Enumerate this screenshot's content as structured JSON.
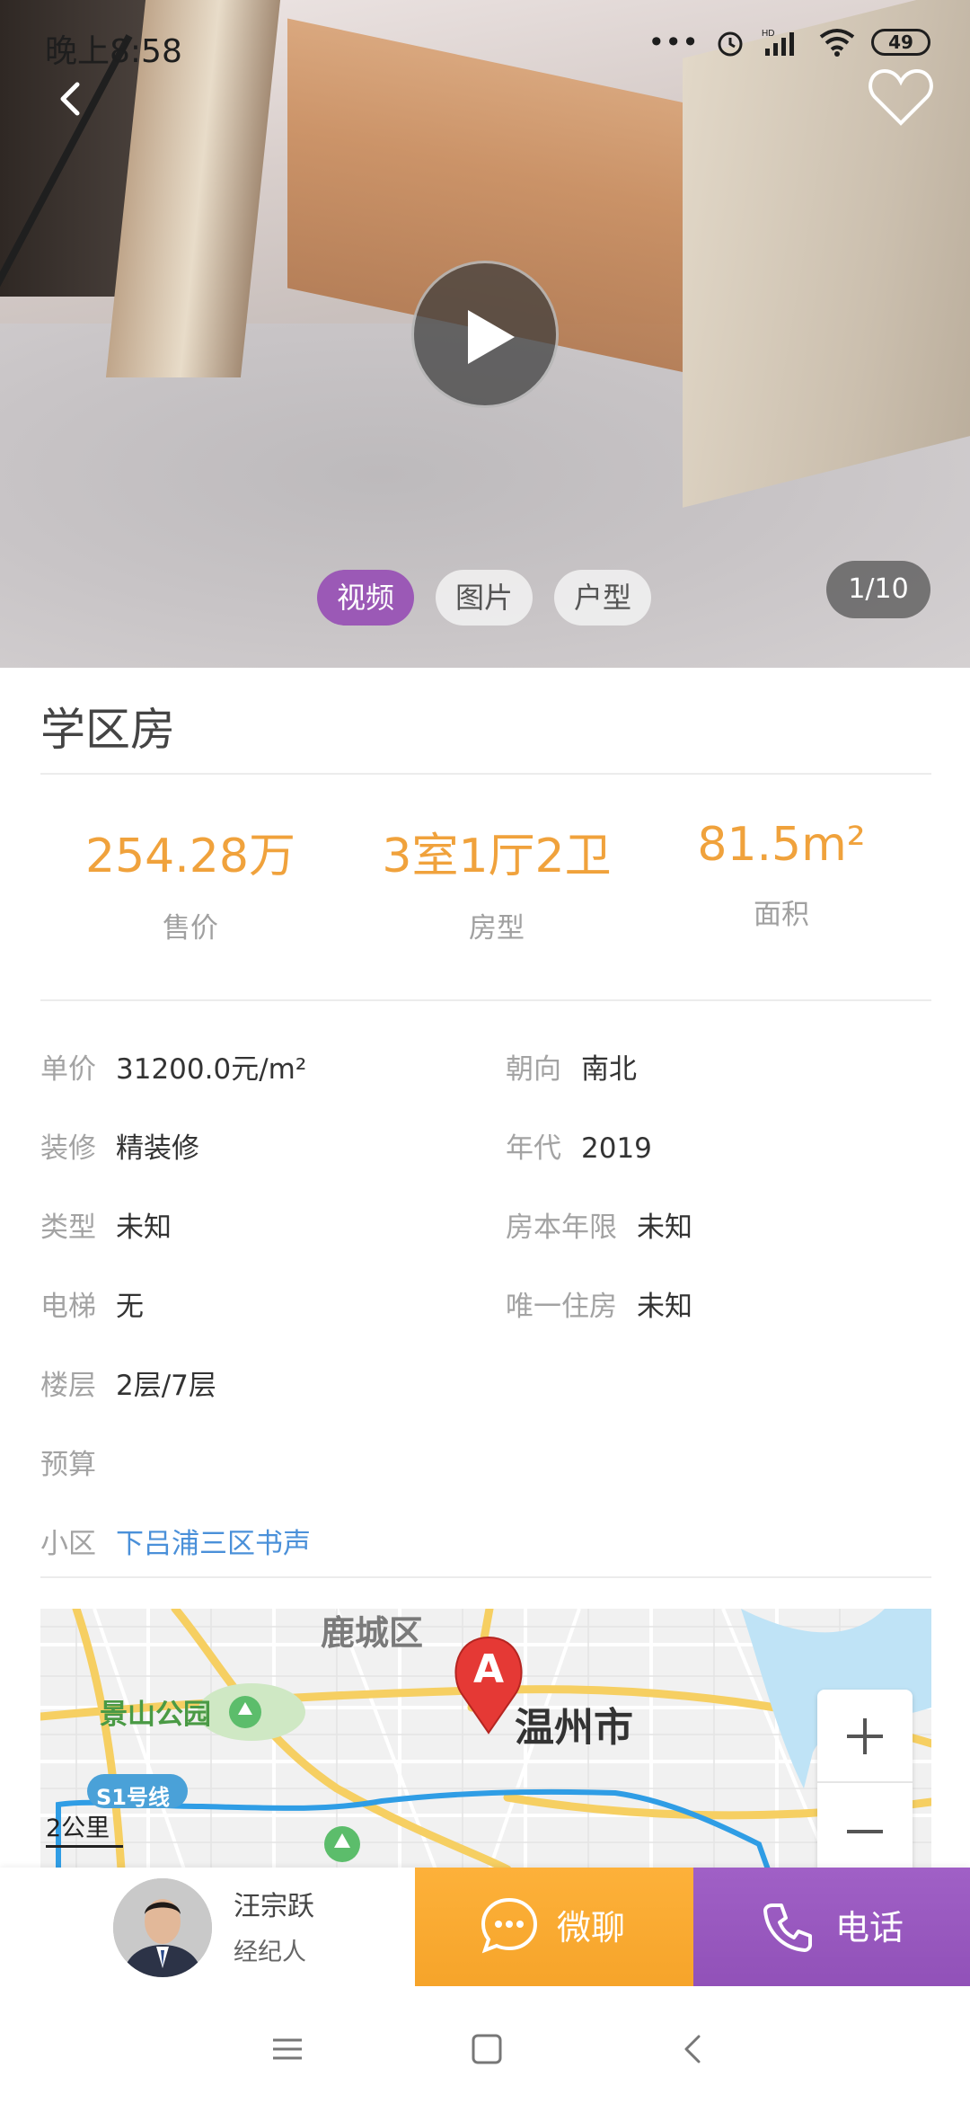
{
  "status_bar": {
    "time": "晚上8:58",
    "battery": "49"
  },
  "media": {
    "tabs": [
      "视频",
      "图片",
      "户型"
    ],
    "active_tab": 0,
    "counter": "1/10"
  },
  "listing": {
    "title": "学区房",
    "stats": [
      {
        "value": "254.28万",
        "label": "售价"
      },
      {
        "value": "3室1厅2卫",
        "label": "房型"
      },
      {
        "value": "81.5m²",
        "label": "面积"
      }
    ],
    "details_left": [
      {
        "label": "单价",
        "value": "31200.0元/m²"
      },
      {
        "label": "装修",
        "value": "精装修"
      },
      {
        "label": "类型",
        "value": "未知"
      },
      {
        "label": "电梯",
        "value": "无"
      },
      {
        "label": "楼层",
        "value": "2层/7层"
      },
      {
        "label": "预算",
        "value": ""
      },
      {
        "label": "小区",
        "value": "下吕浦三区书声"
      }
    ],
    "details_right": [
      {
        "label": "朝向",
        "value": "南北"
      },
      {
        "label": "年代",
        "value": "2019"
      },
      {
        "label": "房本年限",
        "value": "未知"
      },
      {
        "label": "唯一住房",
        "value": "未知"
      }
    ]
  },
  "map": {
    "district": "鹿城区",
    "park": "景山公园",
    "city": "温州市",
    "line": "S1号线",
    "marker": "A",
    "scale": "2公里"
  },
  "agent": {
    "name": "汪宗跃",
    "role": "经纪人"
  },
  "actions": {
    "chat": "微聊",
    "call": "电话"
  },
  "colors": {
    "accent_orange": "#f0a23c",
    "purple": "#9b59b6",
    "link": "#4a90d9"
  }
}
